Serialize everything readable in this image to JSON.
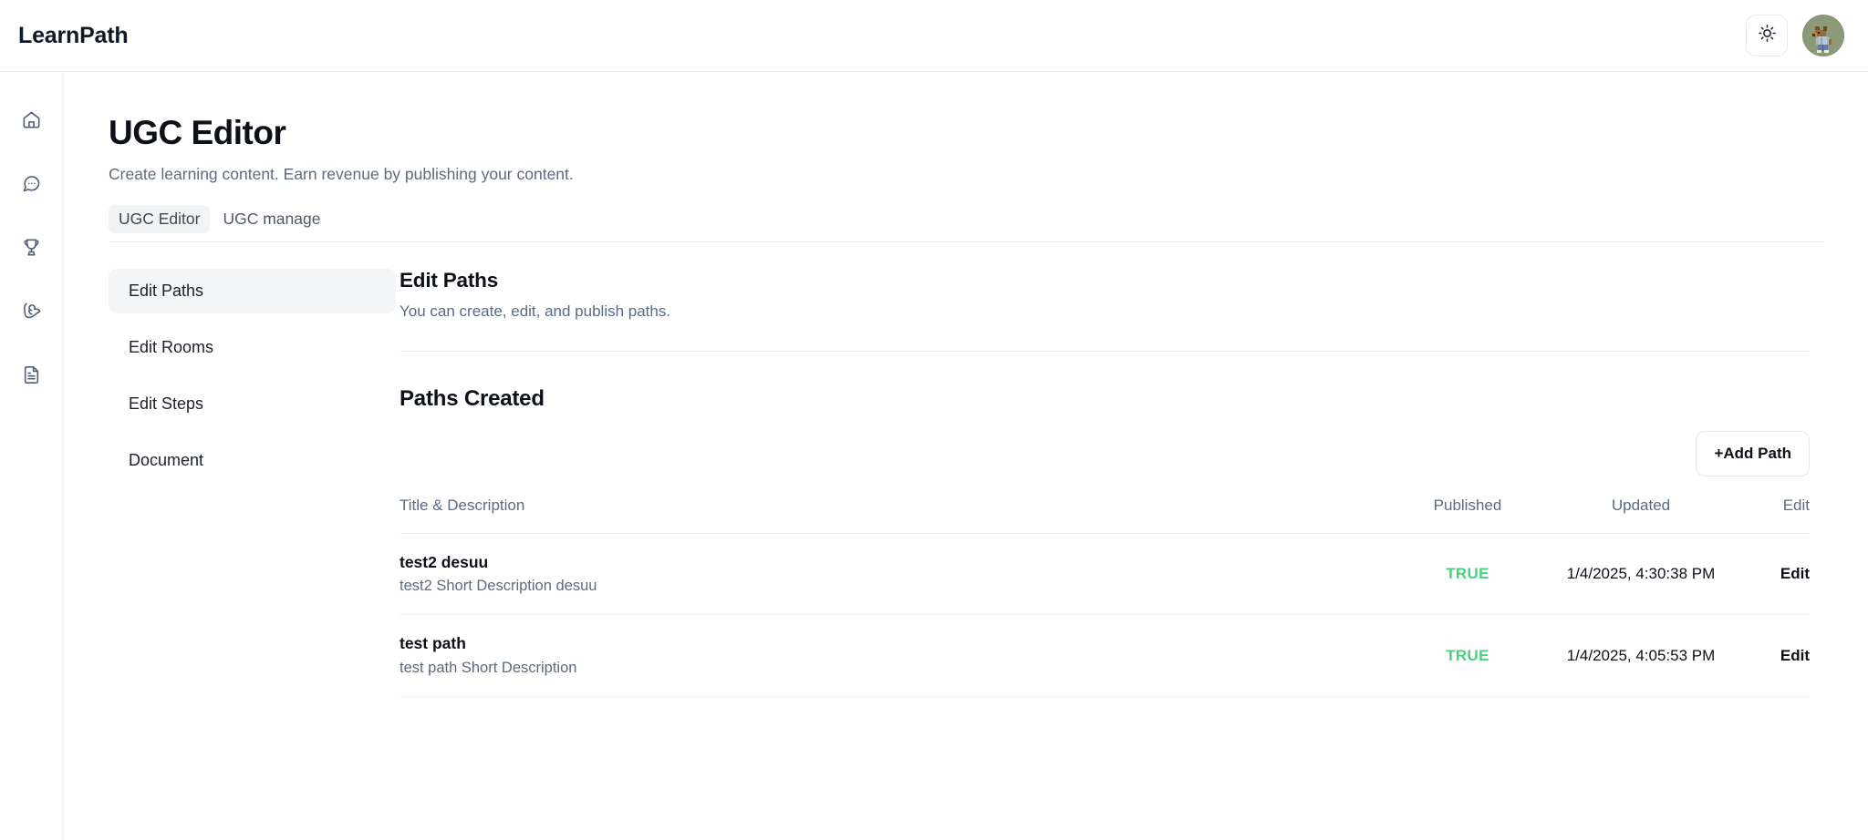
{
  "topbar": {
    "brand": "LearnPath",
    "theme_toggle_icon": "sun-icon",
    "avatar_icon": "user-avatar-dog-pixel-art"
  },
  "rail": {
    "items": [
      {
        "icon": "home-icon",
        "name": "home"
      },
      {
        "icon": "chat-bubble-icon",
        "name": "chat"
      },
      {
        "icon": "trophy-icon",
        "name": "achievements"
      },
      {
        "icon": "muscle-arm-icon",
        "name": "training"
      },
      {
        "icon": "document-icon",
        "name": "documents"
      }
    ]
  },
  "page": {
    "title": "UGC Editor",
    "subtitle": "Create learning content. Earn revenue by publishing your content."
  },
  "tabs": [
    {
      "label": "UGC Editor",
      "active": true
    },
    {
      "label": "UGC manage",
      "active": false
    }
  ],
  "side_menu": [
    {
      "label": "Edit Paths",
      "active": true
    },
    {
      "label": "Edit Rooms",
      "active": false
    },
    {
      "label": "Edit Steps",
      "active": false
    },
    {
      "label": "Document",
      "active": false
    }
  ],
  "section": {
    "title": "Edit Paths",
    "subtitle": "You can create, edit, and publish paths."
  },
  "paths_section": {
    "heading": "Paths Created",
    "add_button": "+Add Path"
  },
  "table": {
    "headers": {
      "title": "Title & Description",
      "published": "Published",
      "updated": "Updated",
      "edit": "Edit"
    },
    "rows": [
      {
        "title": "test2 desuu",
        "description": "test2 Short Description desuu",
        "published": "TRUE",
        "updated": "1/4/2025, 4:30:38 PM",
        "edit": "Edit"
      },
      {
        "title": "test path",
        "description": "test path Short Description",
        "published": "TRUE",
        "updated": "1/4/2025, 4:05:53 PM",
        "edit": "Edit"
      }
    ]
  },
  "colors": {
    "text_primary": "#0d1117",
    "text_muted": "#5a6b83",
    "published_true": "#49d17f",
    "rail_icon": "#546079",
    "border": "#edeff6"
  }
}
